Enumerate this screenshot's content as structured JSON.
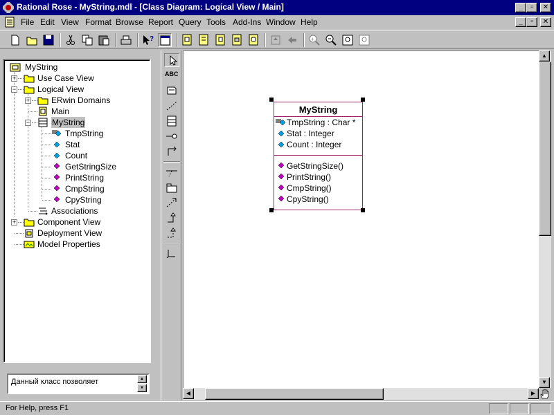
{
  "window": {
    "title": "Rational Rose - MyString.mdl - [Class Diagram: Logical View / Main]"
  },
  "menu": {
    "items": [
      "File",
      "Edit",
      "View",
      "Format",
      "Browse",
      "Report",
      "Query",
      "Tools",
      "Add-Ins",
      "Window",
      "Help"
    ]
  },
  "browser": {
    "root": "MyString",
    "use_case_view": "Use Case View",
    "logical_view": "Logical View",
    "erwin_domains": "ERwin Domains",
    "main": "Main",
    "mystring_class": "MyString",
    "attributes": [
      "TmpString",
      "Stat",
      "Count"
    ],
    "operations": [
      "GetStringSize",
      "PrintString",
      "CmpString",
      "CpyString"
    ],
    "associations": "Associations",
    "component_view": "Component View",
    "deployment_view": "Deployment View",
    "model_properties": "Model Properties"
  },
  "documentation": {
    "text": "Данный класс позволяет"
  },
  "toolbox": {
    "text_tool_label": "ABC"
  },
  "class_box": {
    "name": "MyString",
    "attributes": [
      "TmpString : Char *",
      "Stat : Integer",
      "Count : Integer"
    ],
    "operations": [
      "GetStringSize()",
      "PrintString()",
      "CmpString()",
      "CpyString()"
    ]
  },
  "status": {
    "text": "For Help, press F1"
  },
  "colors": {
    "titlebar": "#000080",
    "class_border": "#a0206a",
    "attribute_icon": "#00a0e0",
    "operation_icon": "#c000c0",
    "folder": "#ffff00"
  },
  "icons": [
    "rose-app-icon",
    "new-icon",
    "open-icon",
    "save-icon",
    "cut-icon",
    "copy-icon",
    "paste-icon",
    "print-icon",
    "context-help-icon",
    "view-doc-icon",
    "browse-class-diagram-icon",
    "browse-interaction-icon",
    "browse-component-icon",
    "browse-deployment-icon",
    "browse-parent-icon",
    "previous-diagram-icon",
    "zoom-in-icon",
    "zoom-out-icon",
    "fit-in-window-icon",
    "undo-fit-icon"
  ]
}
